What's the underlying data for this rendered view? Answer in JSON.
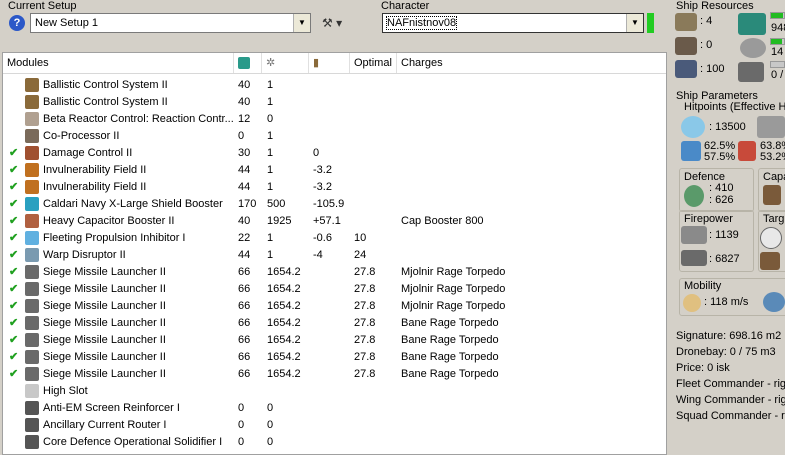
{
  "setup": {
    "label": "Current Setup",
    "value": "New Setup 1",
    "help": "?"
  },
  "character": {
    "label": "Character",
    "value": "NAFnistnov08"
  },
  "modules": {
    "headers": {
      "name": "Modules",
      "optimal": "Optimal",
      "charges": "Charges"
    },
    "rows": [
      {
        "check": false,
        "name": "Ballistic Control System II",
        "cpu": "40",
        "pg": "1",
        "cap": "",
        "optimal": "",
        "charges": "",
        "color": "#8a6a3a"
      },
      {
        "check": false,
        "name": "Ballistic Control System II",
        "cpu": "40",
        "pg": "1",
        "cap": "",
        "optimal": "",
        "charges": "",
        "color": "#8a6a3a"
      },
      {
        "check": false,
        "name": "Beta Reactor Control: Reaction Contr...",
        "cpu": "12",
        "pg": "0",
        "cap": "",
        "optimal": "",
        "charges": "",
        "color": "#b0a090"
      },
      {
        "check": false,
        "name": "Co-Processor II",
        "cpu": "0",
        "pg": "1",
        "cap": "",
        "optimal": "",
        "charges": "",
        "color": "#7a6a5a"
      },
      {
        "check": true,
        "name": "Damage Control II",
        "cpu": "30",
        "pg": "1",
        "cap": "0",
        "optimal": "",
        "charges": "",
        "color": "#a05030"
      },
      {
        "check": true,
        "name": "Invulnerability Field II",
        "cpu": "44",
        "pg": "1",
        "cap": "-3.2",
        "optimal": "",
        "charges": "",
        "color": "#c07020"
      },
      {
        "check": true,
        "name": "Invulnerability Field II",
        "cpu": "44",
        "pg": "1",
        "cap": "-3.2",
        "optimal": "",
        "charges": "",
        "color": "#c07020"
      },
      {
        "check": true,
        "name": "Caldari Navy X-Large Shield Booster",
        "cpu": "170",
        "pg": "500",
        "cap": "-105.9",
        "optimal": "",
        "charges": "",
        "color": "#2aa0c0"
      },
      {
        "check": true,
        "name": "Heavy Capacitor Booster II",
        "cpu": "40",
        "pg": "1925",
        "cap": "+57.1",
        "optimal": "",
        "charges": "Cap Booster 800",
        "color": "#b06040"
      },
      {
        "check": true,
        "name": "Fleeting Propulsion Inhibitor I",
        "cpu": "22",
        "pg": "1",
        "cap": "-0.6",
        "optimal": "10",
        "charges": "",
        "color": "#60b0e0"
      },
      {
        "check": true,
        "name": "Warp Disruptor II",
        "cpu": "44",
        "pg": "1",
        "cap": "-4",
        "optimal": "24",
        "charges": "",
        "color": "#7a9ab0"
      },
      {
        "check": true,
        "name": "Siege Missile Launcher II",
        "cpu": "66",
        "pg": "1654.2",
        "cap": "",
        "optimal": "27.8",
        "charges": "Mjolnir Rage Torpedo",
        "color": "#6a6a6a"
      },
      {
        "check": true,
        "name": "Siege Missile Launcher II",
        "cpu": "66",
        "pg": "1654.2",
        "cap": "",
        "optimal": "27.8",
        "charges": "Mjolnir Rage Torpedo",
        "color": "#6a6a6a"
      },
      {
        "check": true,
        "name": "Siege Missile Launcher II",
        "cpu": "66",
        "pg": "1654.2",
        "cap": "",
        "optimal": "27.8",
        "charges": "Mjolnir Rage Torpedo",
        "color": "#6a6a6a"
      },
      {
        "check": true,
        "name": "Siege Missile Launcher II",
        "cpu": "66",
        "pg": "1654.2",
        "cap": "",
        "optimal": "27.8",
        "charges": "Bane Rage Torpedo",
        "color": "#6a6a6a"
      },
      {
        "check": true,
        "name": "Siege Missile Launcher II",
        "cpu": "66",
        "pg": "1654.2",
        "cap": "",
        "optimal": "27.8",
        "charges": "Bane Rage Torpedo",
        "color": "#6a6a6a"
      },
      {
        "check": true,
        "name": "Siege Missile Launcher II",
        "cpu": "66",
        "pg": "1654.2",
        "cap": "",
        "optimal": "27.8",
        "charges": "Bane Rage Torpedo",
        "color": "#6a6a6a"
      },
      {
        "check": true,
        "name": "Siege Missile Launcher II",
        "cpu": "66",
        "pg": "1654.2",
        "cap": "",
        "optimal": "27.8",
        "charges": "Bane Rage Torpedo",
        "color": "#6a6a6a"
      },
      {
        "check": false,
        "name": "High Slot",
        "cpu": "",
        "pg": "",
        "cap": "",
        "optimal": "",
        "charges": "",
        "color": "#c8c8c8"
      },
      {
        "check": false,
        "name": "Anti-EM Screen Reinforcer I",
        "cpu": "0",
        "pg": "0",
        "cap": "",
        "optimal": "",
        "charges": "",
        "color": "#555555"
      },
      {
        "check": false,
        "name": "Ancillary Current Router I",
        "cpu": "0",
        "pg": "0",
        "cap": "",
        "optimal": "",
        "charges": "",
        "color": "#555555"
      },
      {
        "check": false,
        "name": "Core Defence Operational Solidifier I",
        "cpu": "0",
        "pg": "0",
        "cap": "",
        "optimal": "",
        "charges": "",
        "color": "#555555"
      }
    ]
  },
  "resources": {
    "label": "Ship Resources",
    "turrets": ": 4",
    "launchers": ": 0",
    "calibration": ": 100",
    "cpu": "948",
    "powergrid": "14",
    "drones": "0 /",
    "cpu_fill": 0.9,
    "pg_fill": 0.85,
    "drone_fill": 0.0
  },
  "parameters": {
    "label": "Ship Parameters",
    "hitpoints_label": "Hitpoints (Effective H",
    "shield_hp": ": 13500",
    "shield_res_1": "62.5%",
    "shield_res_2": "57.5%",
    "armor_res_1": "63.8%",
    "armor_res_2": "53.2%",
    "defence_label": "Defence",
    "defence_1": ": 410",
    "defence_2": ": 626",
    "capacitor_label": "Capa",
    "firepower_label": "Firepower",
    "firepower_1": ": 1139",
    "firepower_2": ": 6827",
    "targeting_label": "Targ",
    "mobility_label": "Mobility",
    "speed": ": 118 m/s",
    "signature": "Signature: 698.16 m2",
    "dronebay": "Dronebay: 0 / 75 m3",
    "price": "Price: 0 isk",
    "fleet_commander": "Fleet Commander - right",
    "wing_commander": "Wing Commander - righ",
    "squad_commander": "Squad Commander - rig"
  }
}
